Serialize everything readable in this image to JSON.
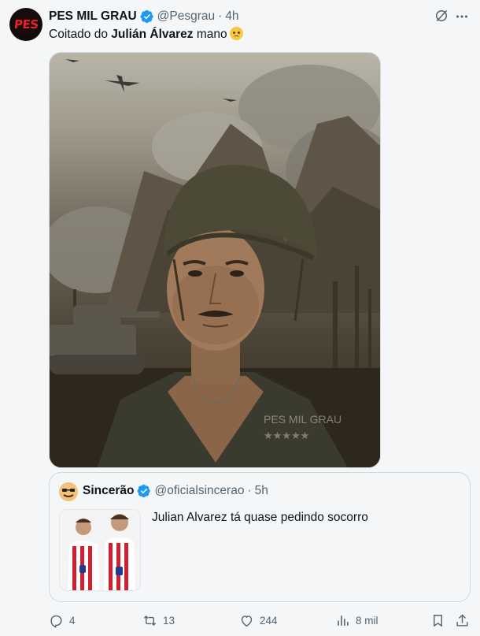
{
  "tweet": {
    "author_name": "PES MIL GRAU",
    "avatar_text": "PES",
    "handle": "@Pesgrau",
    "separator": "·",
    "time": "4h",
    "text_before": "Coitado do ",
    "text_bold": "Julián Álvarez",
    "text_after": " mano",
    "image_watermark": "PES MIL GRAU"
  },
  "quote": {
    "author_name": "Sincerão",
    "handle": "@oficialsincerao",
    "separator": "·",
    "time": "5h",
    "text": "Julian Alvarez tá quase pedindo socorro"
  },
  "actions": {
    "replies": "4",
    "retweets": "13",
    "likes": "244",
    "views": "8 mil"
  },
  "colors": {
    "verified": "#1d9bf0",
    "secondary_text": "#536471",
    "avatar_red": "#e3262b"
  },
  "icons": {
    "grok": "grok-icon",
    "more": "more-icon",
    "reply": "reply-icon",
    "retweet": "retweet-icon",
    "like": "like-icon",
    "views": "views-icon",
    "bookmark": "bookmark-icon",
    "share": "share-icon"
  }
}
